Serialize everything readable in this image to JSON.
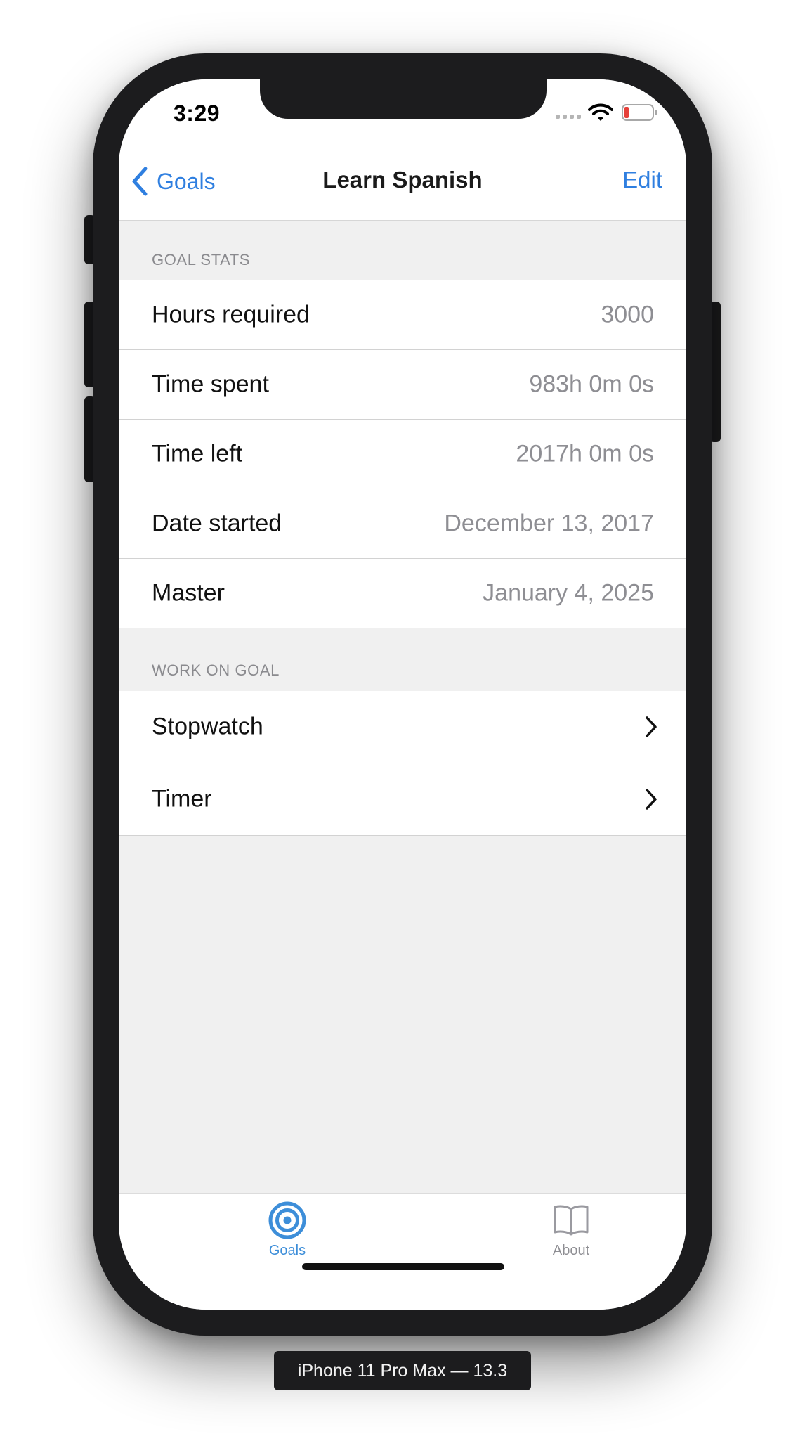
{
  "status_bar": {
    "time": "3:29"
  },
  "nav": {
    "back_label": "Goals",
    "title": "Learn Spanish",
    "edit_label": "Edit"
  },
  "goal_stats": {
    "header": "GOAL STATS",
    "rows": [
      {
        "label": "Hours required",
        "value": "3000"
      },
      {
        "label": "Time spent",
        "value": "983h 0m 0s"
      },
      {
        "label": "Time left",
        "value": "2017h 0m 0s"
      },
      {
        "label": "Date started",
        "value": "December 13, 2017"
      },
      {
        "label": "Master",
        "value": "January 4, 2025"
      }
    ]
  },
  "work_on_goal": {
    "header": "WORK ON GOAL",
    "rows": [
      {
        "label": "Stopwatch"
      },
      {
        "label": "Timer"
      }
    ]
  },
  "tab_bar": {
    "tabs": [
      {
        "label": "Goals",
        "icon": "target-icon",
        "selected": true
      },
      {
        "label": "About",
        "icon": "book-icon",
        "selected": false
      }
    ]
  },
  "device_caption": "iPhone 11 Pro Max — 13.3",
  "colors": {
    "accent": "#2f7fe0",
    "tab_selected": "#3d8ed9",
    "secondary_text": "#8e8e93",
    "grouped_background": "#f0f0f0"
  }
}
